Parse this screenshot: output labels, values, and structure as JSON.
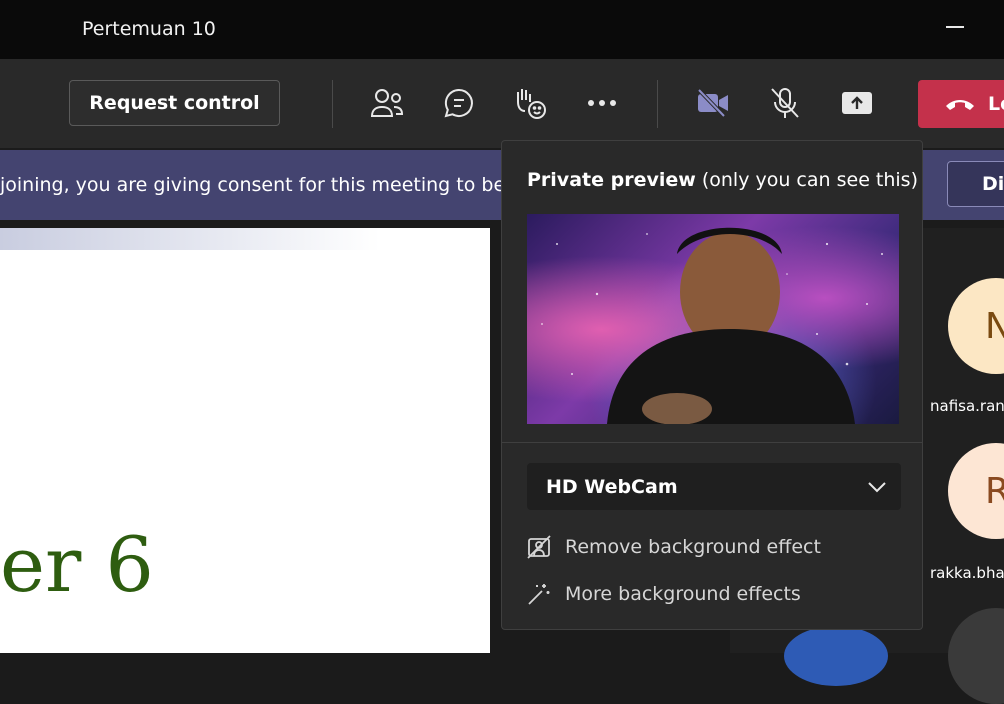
{
  "window": {
    "title": "Pertemuan 10"
  },
  "toolbar": {
    "request_control_label": "Request control",
    "leave_label": "Le",
    "colors": {
      "camera_active": "#8b8cc7",
      "leave": "#c4314b"
    }
  },
  "banner": {
    "message": "joining, you are giving consent for this meeting to be r",
    "dismiss_label": "Di"
  },
  "slide": {
    "text": "er 6"
  },
  "preview": {
    "title_bold": "Private preview",
    "title_rest": " (only you can see this)",
    "camera_name": "HD WebCam",
    "options": [
      {
        "label": "Remove background effect",
        "icon": "no-background-icon"
      },
      {
        "label": "More background effects",
        "icon": "magic-wand-icon"
      }
    ]
  },
  "participants": [
    {
      "initial": "N",
      "name": "nafisa.ran"
    },
    {
      "initial": "R",
      "name": "rakka.bha"
    }
  ]
}
